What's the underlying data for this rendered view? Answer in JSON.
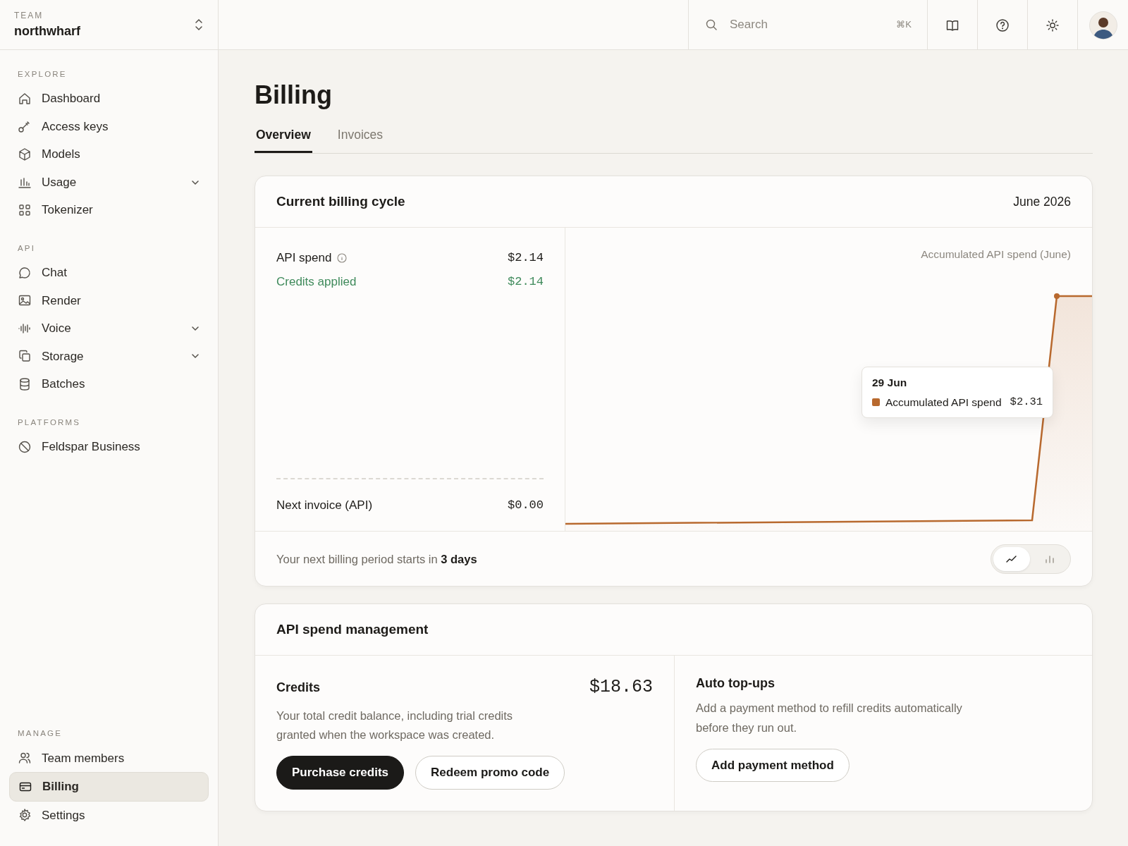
{
  "team": {
    "label": "TEAM",
    "name": "northwharf"
  },
  "search": {
    "placeholder": "Search",
    "shortcut": "⌘K"
  },
  "sidebar": {
    "sections": [
      {
        "title": "EXPLORE",
        "items": [
          {
            "label": "Dashboard",
            "kind": "link",
            "selected": false
          },
          {
            "label": "Access keys",
            "kind": "link",
            "selected": false
          },
          {
            "label": "Models",
            "kind": "link",
            "selected": false
          },
          {
            "label": "Usage",
            "kind": "group",
            "selected": false
          },
          {
            "label": "Tokenizer",
            "kind": "link",
            "selected": false
          }
        ]
      },
      {
        "title": "API",
        "items": [
          {
            "label": "Chat",
            "kind": "link",
            "selected": false
          },
          {
            "label": "Render",
            "kind": "link",
            "selected": false
          },
          {
            "label": "Voice",
            "kind": "group",
            "selected": false
          },
          {
            "label": "Storage",
            "kind": "group",
            "selected": false
          },
          {
            "label": "Batches",
            "kind": "link",
            "selected": false
          }
        ]
      },
      {
        "title": "PLATFORMS",
        "items": [
          {
            "label": "Feldspar Business",
            "kind": "link",
            "selected": false
          }
        ]
      },
      {
        "title": "MANAGE",
        "items": [
          {
            "label": "Team members",
            "kind": "link",
            "selected": false
          },
          {
            "label": "Billing",
            "kind": "link",
            "selected": true
          },
          {
            "label": "Settings",
            "kind": "link",
            "selected": false
          }
        ]
      }
    ]
  },
  "page": {
    "title": "Billing",
    "tabs": [
      {
        "label": "Overview",
        "selected": true
      },
      {
        "label": "Invoices",
        "selected": false
      }
    ]
  },
  "billing_cycle": {
    "title": "Current billing cycle",
    "period": "June 2026",
    "lines": [
      {
        "label": "API spend",
        "value": "$2.14",
        "kind": "info"
      },
      {
        "label": "Credits applied",
        "value": "$2.14",
        "kind": "credit"
      }
    ],
    "next_invoice": {
      "label": "Next invoice (API)",
      "value": "$0.00"
    },
    "chart": {
      "title": "Accumulated API spend (June)",
      "tooltip": {
        "date": "29 Jun",
        "series": "Accumulated API spend",
        "value": "$2.31",
        "color": "#b8692e"
      }
    },
    "footer": "Your next billing period starts in **3 days**",
    "views": [
      {
        "kind": "line",
        "selected": true
      },
      {
        "kind": "bar",
        "selected": false
      }
    ]
  },
  "spend_management": {
    "title": "API spend management",
    "credits": {
      "title": "Credits",
      "amount": "$18.63",
      "text": "Your total credit balance, including trial credits granted when the workspace was created.",
      "buttons": [
        {
          "label": "Purchase credits",
          "kind": "primary"
        },
        {
          "label": "Redeem promo code",
          "kind": "outline"
        }
      ]
    },
    "auto_topups": {
      "title": "Auto top-ups",
      "text": "Add a payment method to refill credits automatically before they run out.",
      "buttons": [
        {
          "label": "Add payment method",
          "kind": "outline"
        }
      ]
    }
  }
}
